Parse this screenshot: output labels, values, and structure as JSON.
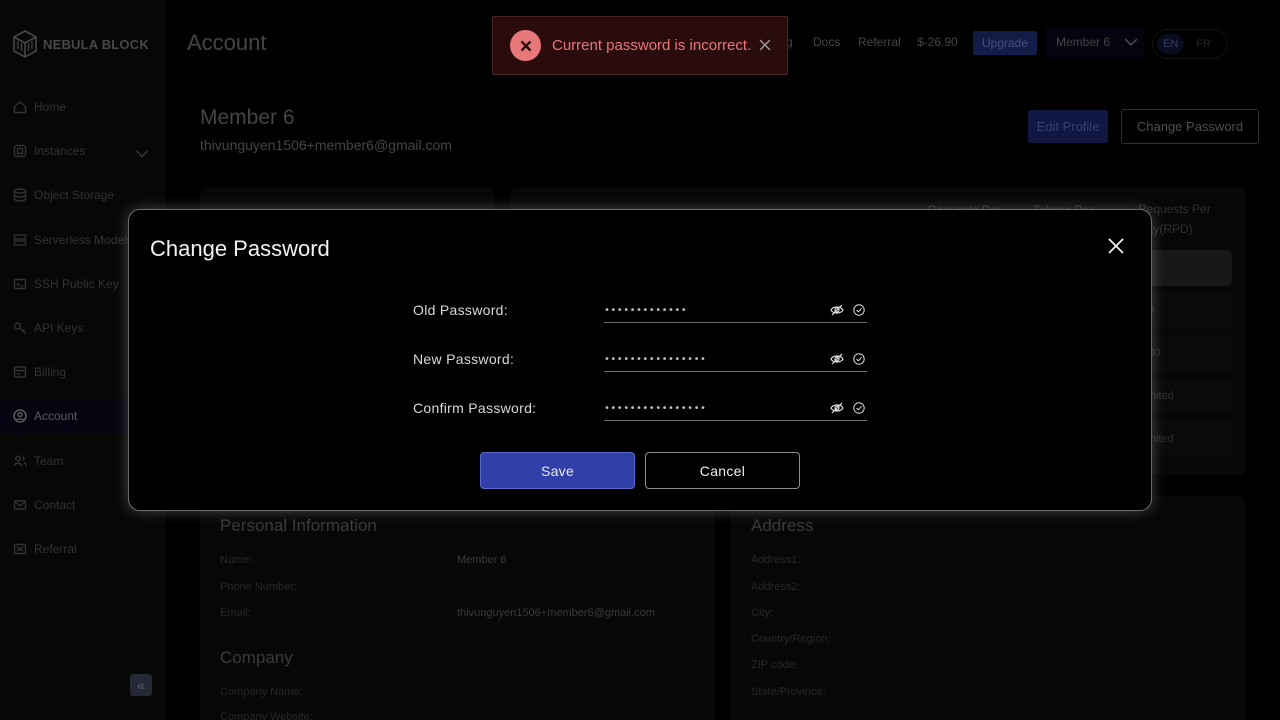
{
  "brand": {
    "name": "NEBULA BLOCK"
  },
  "sidebar": {
    "items": [
      {
        "label": "Home",
        "icon": "home-icon"
      },
      {
        "label": "Instances",
        "icon": "server-icon"
      },
      {
        "label": "Object Storage",
        "icon": "database-icon"
      },
      {
        "label": "Serverless Models",
        "icon": "layers-icon"
      },
      {
        "label": "SSH Public Key",
        "icon": "key-icon"
      },
      {
        "label": "API Keys",
        "icon": "key-icon"
      },
      {
        "label": "Billing",
        "icon": "billing-icon"
      },
      {
        "label": "Account",
        "icon": "user-icon",
        "active": true
      },
      {
        "label": "Team",
        "icon": "team-icon"
      },
      {
        "label": "Contact",
        "icon": "mail-icon"
      },
      {
        "label": "Referral",
        "icon": "gift-icon"
      }
    ],
    "collapse_glyph": "«"
  },
  "header": {
    "title": "Account",
    "nav": {
      "partial": "g",
      "docs": "Docs",
      "referral": "Referral"
    },
    "balance": "$-26.90",
    "upgrade": "Upgrade",
    "member": "Member 6",
    "lang": {
      "active": "EN",
      "inactive": "FR"
    }
  },
  "toast": {
    "message": "Current password is incorrect.",
    "accent": "#e8777a"
  },
  "profile": {
    "name": "Member 6",
    "email": "thivunguyen1506+member6@gmail.com",
    "edit_label": "Edit Profile",
    "change_password_label": "Change Password"
  },
  "rate_limits": {
    "headers": [
      "Requests Per",
      "Tokens Per",
      "Requests Per Day(RPD)"
    ],
    "cells": [
      "0",
      "00",
      "000",
      "limited",
      "limited"
    ]
  },
  "personal": {
    "heading": "Personal Information",
    "name_label": "Name:",
    "name_value": "Member 6",
    "phone_label": "Phone Number:",
    "email_label": "Email:",
    "email_value": "thivunguyen1506+member6@gmail.com"
  },
  "company": {
    "heading": "Company",
    "name_label": "Company Name:",
    "website_label": "Company Website:"
  },
  "address": {
    "heading": "Address",
    "labels": [
      "Address1:",
      "Address2:",
      "City:",
      "Country/Region:",
      "ZIP code:",
      "State/Province:"
    ]
  },
  "modal": {
    "title": "Change Password",
    "old_label": "Old Password:",
    "old_value": "mysecretpass1",
    "new_label": "New Password:",
    "new_value": "mynewpassword123",
    "confirm_label": "Confirm Password:",
    "confirm_value": "mynewpassword123",
    "save": "Save",
    "cancel": "Cancel"
  },
  "colors": {
    "primary": "#3140a8",
    "error": "#e8777a",
    "bg": "#000000"
  }
}
